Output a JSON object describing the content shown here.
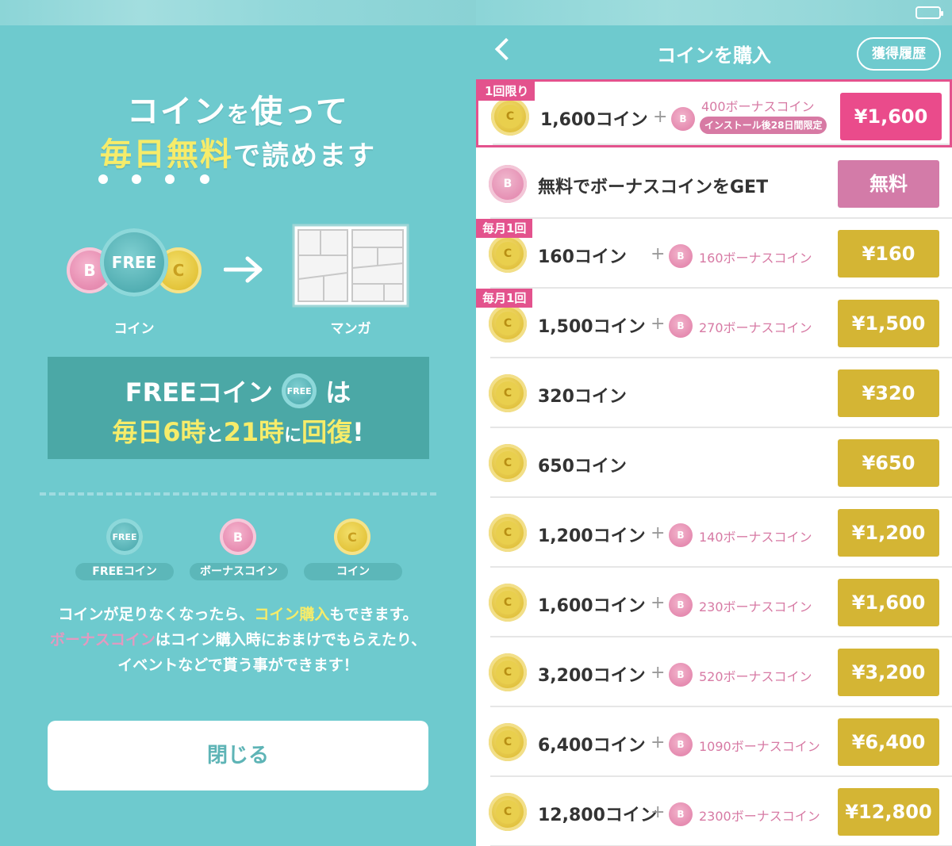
{
  "left": {
    "title_line1_a": "コイン",
    "title_line1_b": "を",
    "title_line1_c": "使って",
    "title_line2_a": "毎日無料",
    "title_line2_b": "で読めます",
    "coin_label": "コイン",
    "manga_label": "マンガ",
    "free_badge": "FREE",
    "b_glyph": "B",
    "c_glyph": "C",
    "panel_line1_a": "FREEコイン",
    "panel_line1_b": "は",
    "panel_line2_a": "毎日6時",
    "panel_line2_b": "と",
    "panel_line2_c": "21時",
    "panel_line2_d": "に",
    "panel_line2_e": "回復",
    "panel_line2_f": "!",
    "legend": [
      {
        "label": "FREEコイン"
      },
      {
        "label": "ボーナスコイン"
      },
      {
        "label": "コイン"
      }
    ],
    "desc_line1_a": "コインが足りなくなったら、",
    "desc_line1_b": "コイン購入",
    "desc_line1_c": "もできます。",
    "desc_line2_a": "ボーナスコイン",
    "desc_line2_b": "はコイン購入時におまけでもらえたり、",
    "desc_line3": "イベントなどで貰う事ができます！",
    "close_button": "閉じる"
  },
  "right": {
    "title": "コインを購入",
    "history_button": "獲得履歴",
    "coin_glyph": "C",
    "bonus_glyph": "B",
    "plus": "+",
    "rows": [
      {
        "ribbon": "1回限り",
        "coins": "1,600コイン",
        "bonus": "400ボーナスコイン",
        "note": "インストール後28日間限定",
        "price": "¥1,600",
        "price_color": "#ea4b8b",
        "highlight": true
      },
      {
        "ribbon": "",
        "coins": "無料でボーナスコインをGET",
        "bonus": "",
        "note": "",
        "price": "無料",
        "price_color": "#d37ba8",
        "bonus_coin_row": true
      },
      {
        "ribbon": "毎月1回",
        "coins": "160コイン",
        "bonus": "160ボーナスコイン",
        "note": "",
        "price": "¥160",
        "price_color": "#d4b534"
      },
      {
        "ribbon": "毎月1回",
        "coins": "1,500コイン",
        "bonus": "270ボーナスコイン",
        "note": "",
        "price": "¥1,500",
        "price_color": "#d4b534"
      },
      {
        "ribbon": "",
        "coins": "320コイン",
        "bonus": "",
        "note": "",
        "price": "¥320",
        "price_color": "#d4b534"
      },
      {
        "ribbon": "",
        "coins": "650コイン",
        "bonus": "",
        "note": "",
        "price": "¥650",
        "price_color": "#d4b534"
      },
      {
        "ribbon": "",
        "coins": "1,200コイン",
        "bonus": "140ボーナスコイン",
        "note": "",
        "price": "¥1,200",
        "price_color": "#d4b534"
      },
      {
        "ribbon": "",
        "coins": "1,600コイン",
        "bonus": "230ボーナスコイン",
        "note": "",
        "price": "¥1,600",
        "price_color": "#d4b534"
      },
      {
        "ribbon": "",
        "coins": "3,200コイン",
        "bonus": "520ボーナスコイン",
        "note": "",
        "price": "¥3,200",
        "price_color": "#d4b534"
      },
      {
        "ribbon": "",
        "coins": "6,400コイン",
        "bonus": "1090ボーナスコイン",
        "note": "",
        "price": "¥6,400",
        "price_color": "#d4b534"
      },
      {
        "ribbon": "",
        "coins": "12,800コイン",
        "bonus": "2300ボーナスコイン",
        "note": "",
        "price": "¥12,800",
        "price_color": "#d4b534"
      }
    ]
  },
  "colors": {
    "teal": "#6ecace",
    "yellow_text": "#f6ec6a",
    "pink_accent": "#e3528d",
    "gold_button": "#d4b534"
  }
}
